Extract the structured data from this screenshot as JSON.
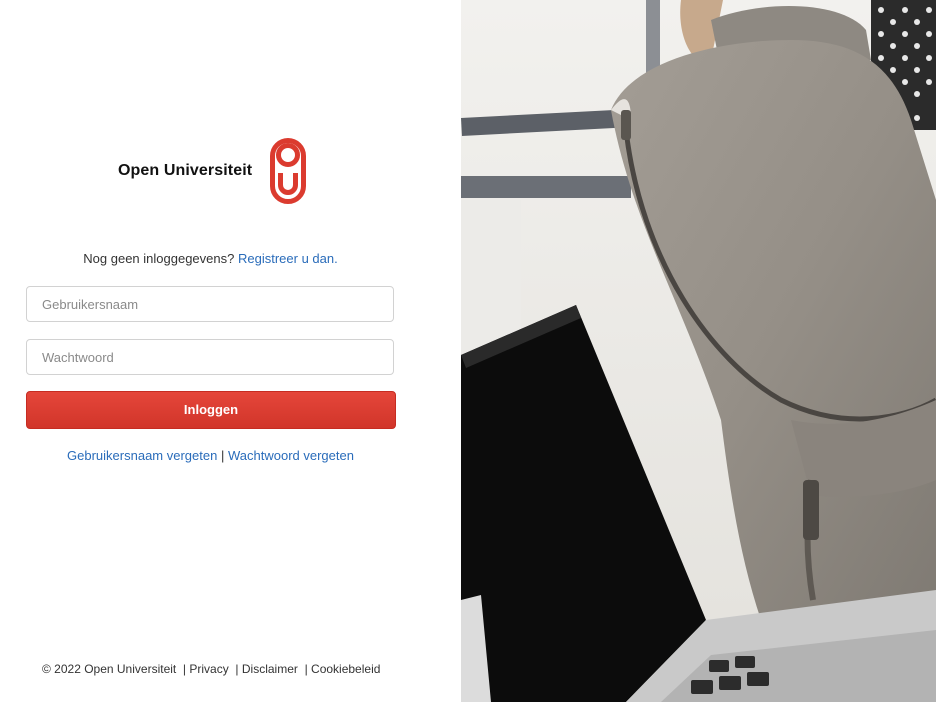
{
  "brand": {
    "name": "Open Universiteit",
    "accent_color": "#db3b2f",
    "link_color": "#2a6cba"
  },
  "register": {
    "prompt": "Nog geen inloggegevens?",
    "link_label": "Registreer u dan."
  },
  "form": {
    "username_placeholder": "Gebruikersnaam",
    "password_placeholder": "Wachtwoord",
    "submit_label": "Inloggen"
  },
  "forgot": {
    "username_label": "Gebruikersnaam vergeten",
    "separator": "|",
    "password_label": "Wachtwoord vergeten"
  },
  "footer": {
    "copyright": "© 2022 Open Universiteit",
    "links": [
      "Privacy",
      "Disclaimer",
      "Cookiebeleid"
    ]
  },
  "hero_image": {
    "icon": "photo-backpack-laptop"
  }
}
